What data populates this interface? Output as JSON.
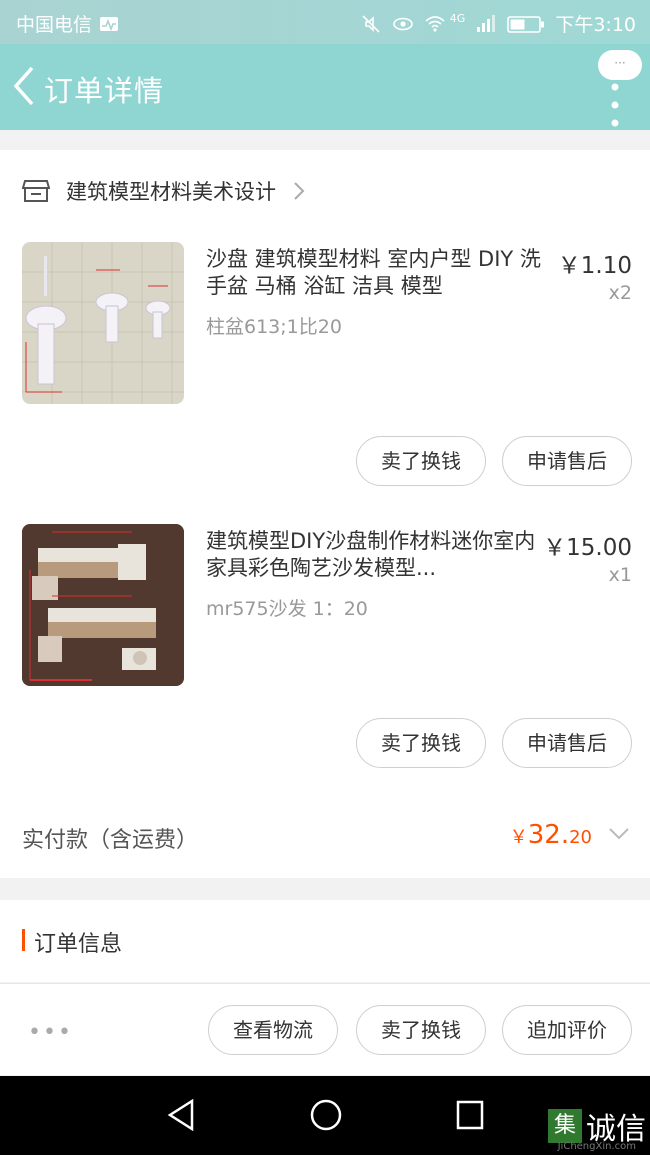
{
  "status_bar": {
    "carrier": "中国电信",
    "time": "下午3:10",
    "network": "4G"
  },
  "header": {
    "title": "订单详情",
    "bubble": "···"
  },
  "shop": {
    "name": "建筑模型材料美术设计"
  },
  "items": [
    {
      "title": "沙盘 建筑模型材料 室内户型 DIY 洗手盆 马桶 浴缸 洁具 模型",
      "spec": "柱盆613;1比20",
      "price": "￥1.10",
      "qty": "x2",
      "btn_sell": "卖了换钱",
      "btn_after": "申请售后"
    },
    {
      "title": "建筑模型DIY沙盘制作材料迷你室内家具彩色陶艺沙发模型...",
      "spec": "mr575沙发 1：20",
      "price": "￥15.00",
      "qty": "x1",
      "btn_sell": "卖了换钱",
      "btn_after": "申请售后"
    }
  ],
  "payment": {
    "label": "实付款（含运费）",
    "currency": "￥",
    "integer": "32.",
    "decimal": "20"
  },
  "order_info": {
    "title": "订单信息"
  },
  "bottom_actions": {
    "more": "•••",
    "logistics": "查看物流",
    "sell": "卖了换钱",
    "review": "追加评价"
  },
  "watermark": {
    "logo": "集",
    "text": "诚信",
    "sub": "JiChengXin.com"
  },
  "colors": {
    "accent": "#ff5000",
    "header": "#8fd6d2",
    "nav": "#000000"
  }
}
